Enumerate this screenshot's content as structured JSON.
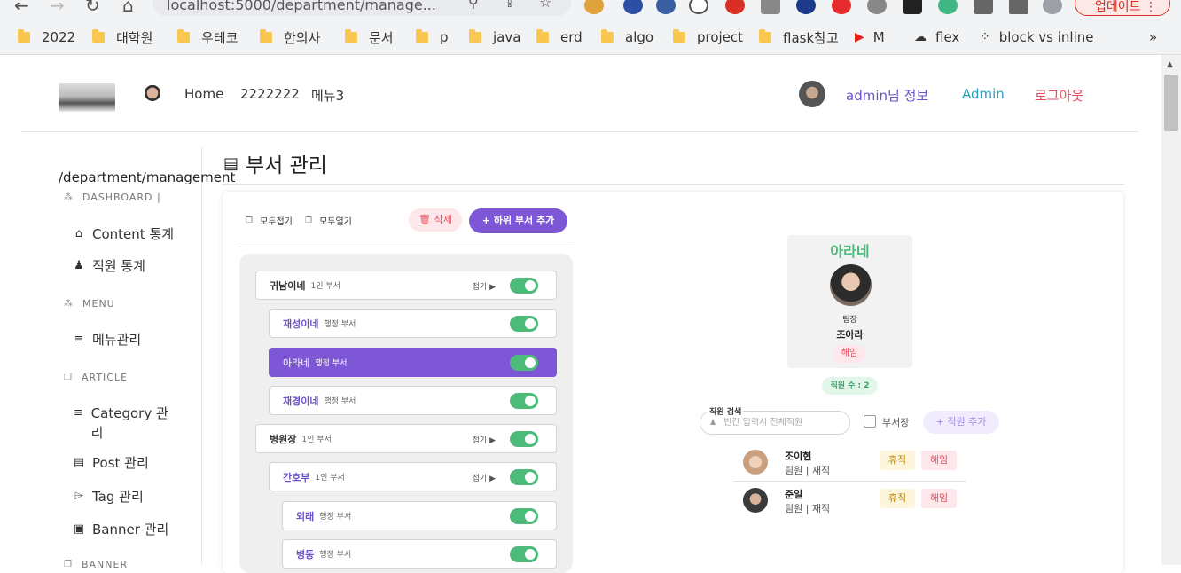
{
  "browser": {
    "url": "localhost:5000/department/manage...",
    "update_label": "업데이트",
    "bookmarks": [
      {
        "label": "2022",
        "icon": "folder-icon"
      },
      {
        "label": "대학원",
        "icon": "folder-icon"
      },
      {
        "label": "우테코",
        "icon": "folder-icon"
      },
      {
        "label": "한의사",
        "icon": "folder-icon"
      },
      {
        "label": "문서",
        "icon": "folder-icon"
      },
      {
        "label": "p",
        "icon": "folder-icon"
      },
      {
        "label": "java",
        "icon": "folder-icon"
      },
      {
        "label": "erd",
        "icon": "folder-icon"
      },
      {
        "label": "algo",
        "icon": "folder-icon"
      },
      {
        "label": "project",
        "icon": "folder-icon"
      },
      {
        "label": "flask참고",
        "icon": "folder-icon"
      },
      {
        "label": "M",
        "icon": "youtube-icon"
      },
      {
        "label": "flex",
        "icon": "cloud-icon"
      },
      {
        "label": "block vs inline",
        "icon": "dots-icon"
      }
    ],
    "more_bookmarks": "»"
  },
  "header": {
    "nav": [
      "Home",
      "2222222",
      "메뉴3"
    ],
    "user_info": "admin님 정보",
    "admin_label": "Admin",
    "logout_label": "로그아웃",
    "colors": {
      "user_info": "#6b52c9",
      "admin": "#2aa3b8",
      "logout": "#e74c5c"
    }
  },
  "sidebar": {
    "path": "/department/management",
    "sections": [
      {
        "title": "DASHBOARD |",
        "icon": "dashboard-icon",
        "items": [
          {
            "label": "Content 통계",
            "icon": "home-icon"
          },
          {
            "label": "직원 통계",
            "icon": "user-chart-icon"
          }
        ]
      },
      {
        "title": "MENU",
        "icon": "sitemap-icon",
        "items": [
          {
            "label": "메뉴관리",
            "icon": "list-icon"
          }
        ]
      },
      {
        "title": "ARTICLE",
        "icon": "copy-icon",
        "items": [
          {
            "label": "Category 관리",
            "icon": "list-icon"
          },
          {
            "label": "Post 관리",
            "icon": "clipboard-icon"
          },
          {
            "label": "Tag 관리",
            "icon": "tag-icon"
          },
          {
            "label": "Banner 관리",
            "icon": "image-icon"
          }
        ]
      },
      {
        "title": "BANNER",
        "icon": "banner-icon",
        "items": []
      }
    ]
  },
  "main": {
    "title": "부서 관리",
    "toolbar": {
      "collapse_all": "모두접기",
      "expand_all": "모두열기",
      "delete": "삭제",
      "add_sub": "하위 부서 추가"
    },
    "tree": [
      {
        "name": "귀남이네",
        "desc": "1인 부서",
        "fold": "접기",
        "level": 0,
        "selected": false,
        "enabled": true
      },
      {
        "name": "재성이네",
        "desc": "행정 부서",
        "fold": "",
        "level": 1,
        "selected": false,
        "enabled": true
      },
      {
        "name": "아라네",
        "desc": "행정 부서",
        "fold": "",
        "level": 1,
        "selected": true,
        "enabled": true
      },
      {
        "name": "재경이네",
        "desc": "행정 부서",
        "fold": "",
        "level": 1,
        "selected": false,
        "enabled": true
      },
      {
        "name": "병원장",
        "desc": "1인 부서",
        "fold": "접기",
        "level": 0,
        "selected": false,
        "enabled": true
      },
      {
        "name": "간호부",
        "desc": "1인 부서",
        "fold": "접기",
        "level": 1,
        "selected": false,
        "enabled": true
      },
      {
        "name": "외래",
        "desc": "행정 부서",
        "fold": "",
        "level": 2,
        "selected": false,
        "enabled": true
      },
      {
        "name": "병동",
        "desc": "행정 부서",
        "fold": "",
        "level": 2,
        "selected": false,
        "enabled": true
      }
    ],
    "detail": {
      "dept_name": "아라네",
      "leader_role": "팀장",
      "leader_name": "조아라",
      "fire_label": "해임",
      "employee_count": "직원 수 : 2",
      "search_label": "직원 검색",
      "search_placeholder": "빈칸 입력시 전체직원",
      "search_value": "",
      "leader_checkbox_label": "부서장",
      "add_employee": "직원 추가",
      "employees": [
        {
          "name": "조이현",
          "meta": "팀원 | 재직",
          "leave": "휴직",
          "fire": "해임"
        },
        {
          "name": "준일",
          "meta": "팀원 | 재직",
          "leave": "휴직",
          "fire": "해임"
        }
      ]
    }
  }
}
